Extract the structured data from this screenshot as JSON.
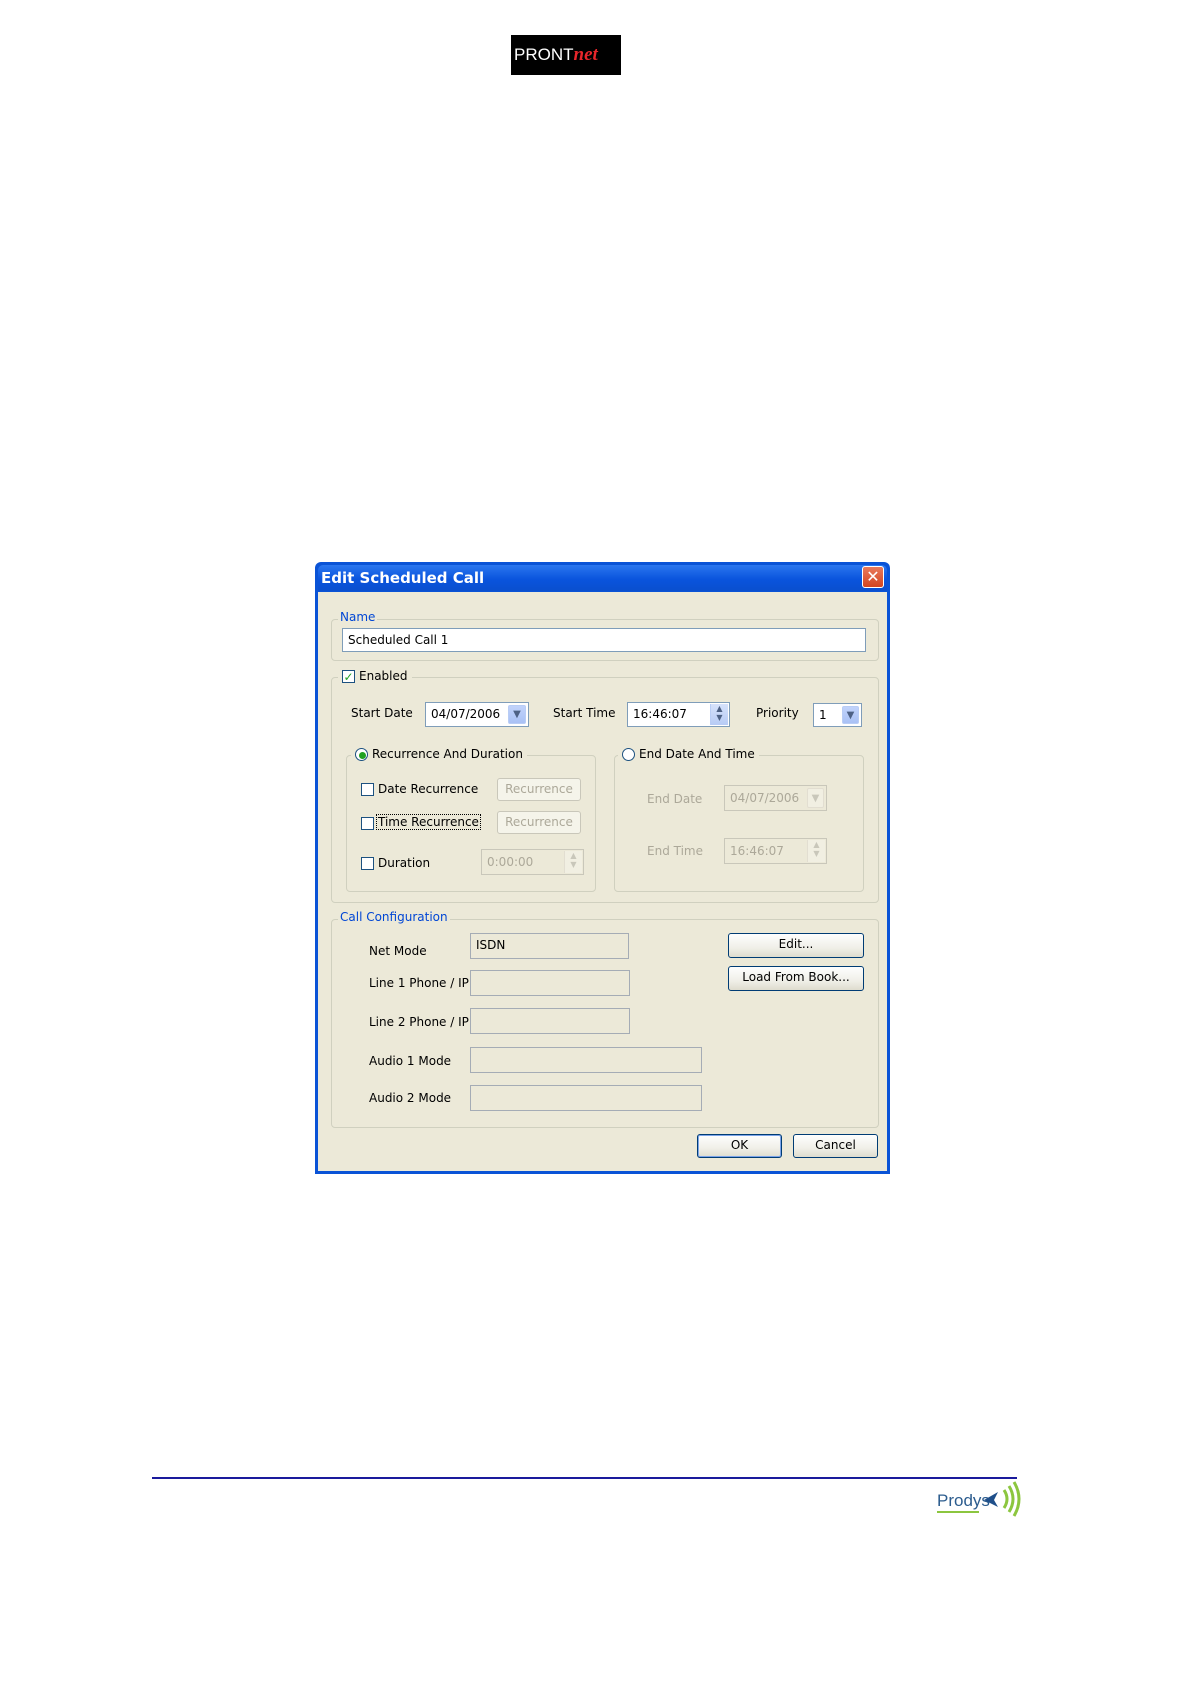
{
  "header": {
    "logo_text": "PRONT",
    "logo_text_accent": "net"
  },
  "dialog": {
    "title": "Edit Scheduled Call",
    "name_group": {
      "legend": "Name",
      "value": "Scheduled Call 1"
    },
    "schedule": {
      "enabled_label": "Enabled",
      "enabled": true,
      "start_date_label": "Start Date",
      "start_date": "04/07/2006",
      "start_time_label": "Start Time",
      "start_time": "16:46:07",
      "priority_label": "Priority",
      "priority": "1",
      "recurrence_group": {
        "label": "Recurrence And Duration",
        "selected": true,
        "date_recurrence_label": "Date Recurrence",
        "time_recurrence_label": "Time Recurrence",
        "duration_label": "Duration",
        "recurrence_button_1": "Recurrence",
        "recurrence_button_2": "Recurrence",
        "duration_value": "0:00:00"
      },
      "end_group": {
        "label": "End Date And Time",
        "selected": false,
        "end_date_label": "End Date",
        "end_date": "04/07/2006",
        "end_time_label": "End Time",
        "end_time": "16:46:07"
      }
    },
    "call_config": {
      "legend": "Call Configuration",
      "net_mode_label": "Net Mode",
      "net_mode": "ISDN",
      "line1_label": "Line 1 Phone / IP",
      "line1": "",
      "line2_label": "Line 2 Phone / IP",
      "line2": "",
      "audio1_label": "Audio 1 Mode",
      "audio1": "",
      "audio2_label": "Audio 2 Mode",
      "audio2": "",
      "edit_button": "Edit...",
      "load_button": "Load From Book..."
    },
    "ok_button": "OK",
    "cancel_button": "Cancel"
  },
  "footer": {
    "logo_text": "Prodys"
  },
  "colors": {
    "titlebar": "#0a54dd",
    "dialog_face": "#ece9d8",
    "group_label": "#0046d5",
    "footer_rule": "#1a1a9c"
  }
}
